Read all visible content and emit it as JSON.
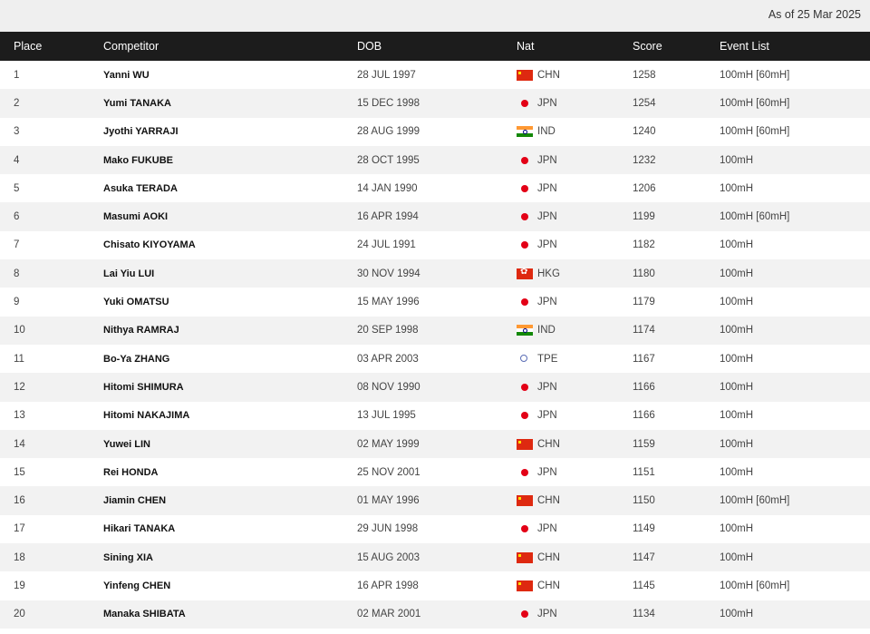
{
  "header": {
    "as_of": "As of 25 Mar 2025"
  },
  "columns": {
    "place": "Place",
    "competitor": "Competitor",
    "dob": "DOB",
    "nat": "Nat",
    "score": "Score",
    "events": "Event List"
  },
  "rows": [
    {
      "place": "1",
      "competitor": "Yanni WU",
      "dob": "28 JUL 1997",
      "flag_icon": "china-flag-icon",
      "nat": "CHN",
      "score": "1258",
      "events": "100mH [60mH]"
    },
    {
      "place": "2",
      "competitor": "Yumi TANAKA",
      "dob": "15 DEC 1998",
      "flag_icon": "japan-flag-icon",
      "nat": "JPN",
      "score": "1254",
      "events": "100mH [60mH]"
    },
    {
      "place": "3",
      "competitor": "Jyothi YARRAJI",
      "dob": "28 AUG 1999",
      "flag_icon": "india-flag-icon",
      "nat": "IND",
      "score": "1240",
      "events": "100mH [60mH]"
    },
    {
      "place": "4",
      "competitor": "Mako FUKUBE",
      "dob": "28 OCT 1995",
      "flag_icon": "japan-flag-icon",
      "nat": "JPN",
      "score": "1232",
      "events": "100mH"
    },
    {
      "place": "5",
      "competitor": "Asuka TERADA",
      "dob": "14 JAN 1990",
      "flag_icon": "japan-flag-icon",
      "nat": "JPN",
      "score": "1206",
      "events": "100mH"
    },
    {
      "place": "6",
      "competitor": "Masumi AOKI",
      "dob": "16 APR 1994",
      "flag_icon": "japan-flag-icon",
      "nat": "JPN",
      "score": "1199",
      "events": "100mH [60mH]"
    },
    {
      "place": "7",
      "competitor": "Chisato KIYOYAMA",
      "dob": "24 JUL 1991",
      "flag_icon": "japan-flag-icon",
      "nat": "JPN",
      "score": "1182",
      "events": "100mH"
    },
    {
      "place": "8",
      "competitor": "Lai Yiu LUI",
      "dob": "30 NOV 1994",
      "flag_icon": "hong-kong-flag-icon",
      "nat": "HKG",
      "score": "1180",
      "events": "100mH"
    },
    {
      "place": "9",
      "competitor": "Yuki OMATSU",
      "dob": "15 MAY 1996",
      "flag_icon": "japan-flag-icon",
      "nat": "JPN",
      "score": "1179",
      "events": "100mH"
    },
    {
      "place": "10",
      "competitor": "Nithya RAMRAJ",
      "dob": "20 SEP 1998",
      "flag_icon": "india-flag-icon",
      "nat": "IND",
      "score": "1174",
      "events": "100mH"
    },
    {
      "place": "11",
      "competitor": "Bo-Ya ZHANG",
      "dob": "03 APR 2003",
      "flag_icon": "chinese-taipei-flag-icon",
      "nat": "TPE",
      "score": "1167",
      "events": "100mH"
    },
    {
      "place": "12",
      "competitor": "Hitomi SHIMURA",
      "dob": "08 NOV 1990",
      "flag_icon": "japan-flag-icon",
      "nat": "JPN",
      "score": "1166",
      "events": "100mH"
    },
    {
      "place": "13",
      "competitor": "Hitomi NAKAJIMA",
      "dob": "13 JUL 1995",
      "flag_icon": "japan-flag-icon",
      "nat": "JPN",
      "score": "1166",
      "events": "100mH"
    },
    {
      "place": "14",
      "competitor": "Yuwei LIN",
      "dob": "02 MAY 1999",
      "flag_icon": "china-flag-icon",
      "nat": "CHN",
      "score": "1159",
      "events": "100mH"
    },
    {
      "place": "15",
      "competitor": "Rei HONDA",
      "dob": "25 NOV 2001",
      "flag_icon": "japan-flag-icon",
      "nat": "JPN",
      "score": "1151",
      "events": "100mH"
    },
    {
      "place": "16",
      "competitor": "Jiamin CHEN",
      "dob": "01 MAY 1996",
      "flag_icon": "china-flag-icon",
      "nat": "CHN",
      "score": "1150",
      "events": "100mH [60mH]"
    },
    {
      "place": "17",
      "competitor": "Hikari TANAKA",
      "dob": "29 JUN 1998",
      "flag_icon": "japan-flag-icon",
      "nat": "JPN",
      "score": "1149",
      "events": "100mH"
    },
    {
      "place": "18",
      "competitor": "Sining XIA",
      "dob": "15 AUG 2003",
      "flag_icon": "china-flag-icon",
      "nat": "CHN",
      "score": "1147",
      "events": "100mH"
    },
    {
      "place": "19",
      "competitor": "Yinfeng CHEN",
      "dob": "16 APR 1998",
      "flag_icon": "china-flag-icon",
      "nat": "CHN",
      "score": "1145",
      "events": "100mH [60mH]"
    },
    {
      "place": "20",
      "competitor": "Manaka SHIBATA",
      "dob": "02 MAR 2001",
      "flag_icon": "japan-flag-icon",
      "nat": "JPN",
      "score": "1134",
      "events": "100mH"
    }
  ]
}
